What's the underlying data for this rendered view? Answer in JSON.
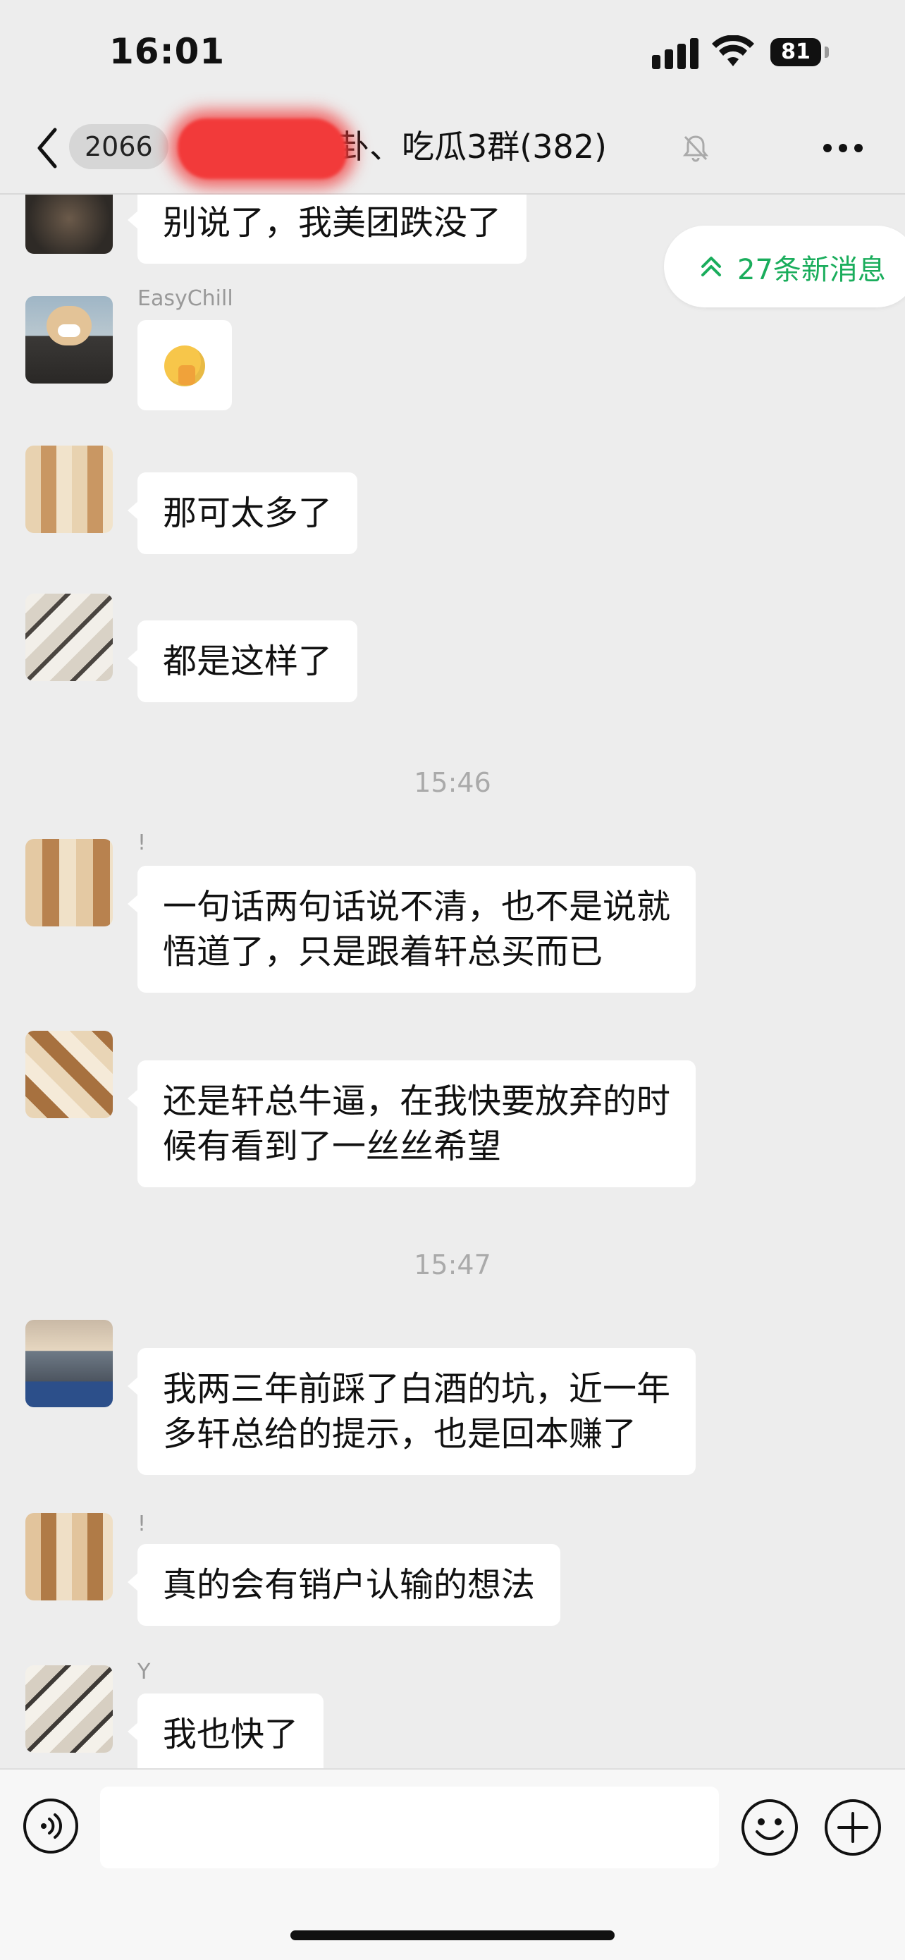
{
  "status_bar": {
    "time": "16:01",
    "battery": "81"
  },
  "nav": {
    "unread_count": "2066",
    "title": "八卦、吃瓜3群(382)"
  },
  "new_messages_chip": {
    "label": "27条新消息"
  },
  "messages": [
    {
      "sender": "",
      "text": "别说了，我美团跌没了"
    },
    {
      "sender": "EasyChill",
      "text": "",
      "emoji": "face-with-hand-over-mouth-emoji"
    },
    {
      "sender": "",
      "text": "那可太多了"
    },
    {
      "sender": "",
      "text": "都是这样了"
    },
    {
      "sender": "!",
      "text": "一句话两句话说不清，也不是说就\n悟道了，只是跟着轩总买而已"
    },
    {
      "sender": "",
      "text": "还是轩总牛逼，在我快要放弃的时\n候有看到了一丝丝希望"
    },
    {
      "sender": "",
      "text": "我两三年前踩了白酒的坑，近一年\n多轩总给的提示，也是回本赚了"
    },
    {
      "sender": "!",
      "text": "真的会有销户认输的想法"
    },
    {
      "sender": "Y",
      "text": "我也快了"
    }
  ],
  "timestamps": [
    "15:46",
    "15:47"
  ],
  "input_bar": {
    "placeholder": ""
  },
  "colors": {
    "accent": "#1aad5c",
    "background": "#ededed",
    "redaction": "#f23a3a"
  }
}
